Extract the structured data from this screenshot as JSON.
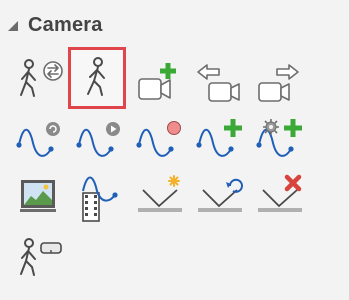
{
  "panel": {
    "title": "Camera",
    "rows": [
      {
        "tools": [
          {
            "name": "walk-through-icon",
            "selected": false
          },
          {
            "name": "walk-icon",
            "selected": true
          },
          {
            "name": "add-camera-icon",
            "selected": false
          },
          {
            "name": "previous-camera-icon",
            "selected": false
          },
          {
            "name": "next-camera-icon",
            "selected": false
          }
        ]
      },
      {
        "tools": [
          {
            "name": "path-settings-icon",
            "selected": false
          },
          {
            "name": "path-play-icon",
            "selected": false
          },
          {
            "name": "path-record-icon",
            "selected": false
          },
          {
            "name": "path-add-icon",
            "selected": false
          },
          {
            "name": "path-add-settings-icon",
            "selected": false
          }
        ]
      },
      {
        "tools": [
          {
            "name": "screenshot-icon",
            "selected": false
          },
          {
            "name": "path-video-icon",
            "selected": false
          },
          {
            "name": "sun-light-icon",
            "selected": false
          },
          {
            "name": "refresh-light-icon",
            "selected": false
          },
          {
            "name": "delete-light-icon",
            "selected": false
          }
        ]
      },
      {
        "tools": [
          {
            "name": "vr-walk-icon",
            "selected": false
          }
        ]
      }
    ],
    "colors": {
      "accent_green": "#3aa935",
      "selection_border": "#e0454b",
      "path_blue": "#1f5fb8",
      "delete_red": "#d9433d",
      "sun_yellow": "#f2b12b"
    }
  }
}
